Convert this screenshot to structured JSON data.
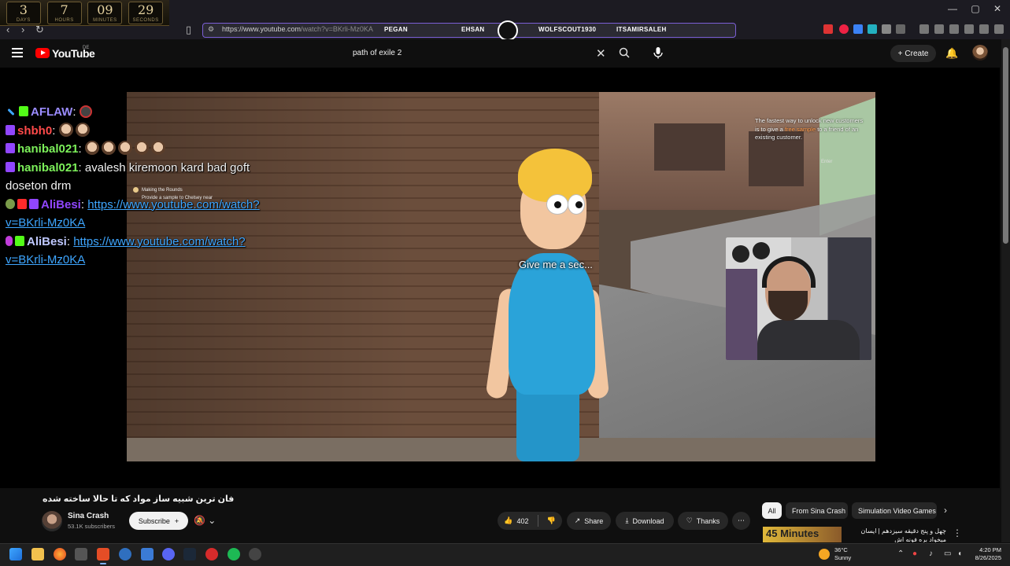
{
  "countdown": {
    "days": "3",
    "days_label": "DAYS",
    "hours": "7",
    "hours_label": "HOURS",
    "minutes": "09",
    "minutes_label": "MINUTES",
    "seconds": "29",
    "seconds_label": "SECONDS"
  },
  "browser": {
    "url_main": "https://www.youtube.com",
    "url_rest": "/watch?v=BKrli-Mz0KA",
    "tags": [
      "PEGAN",
      "EHSAN",
      "WOLFSCOUT1930",
      "ITSAMIRSALEH"
    ]
  },
  "youtube": {
    "wordmark": "YouTube",
    "region": "DE",
    "search_value": "path of exile 2",
    "create_label": "Create"
  },
  "chat": [
    {
      "user": "AFLAW",
      "color": "#9b8cff",
      "text": ""
    },
    {
      "user": "shbh0",
      "color": "#ff4a4a",
      "text": ""
    },
    {
      "user": "hanibal021",
      "color": "#7cf05a",
      "text": ""
    },
    {
      "user": "hanibal021",
      "color": "#7cf05a",
      "text": "avalesh kiremoon kard bad goft"
    },
    {
      "text_cont": "doseton drm"
    },
    {
      "user": "AliBesi",
      "color": "#9146ff",
      "link": "https://www.youtube.com/watch?"
    },
    {
      "link_cont": "v=BKrli-Mz0KA"
    },
    {
      "user": "AliBesi",
      "color": "#bfc8ff",
      "link": "https://www.youtube.com/watch?"
    },
    {
      "link_cont2": "v=BKrli-Mz0KA"
    }
  ],
  "game": {
    "subtitle": "Give me a sec...",
    "quest_title": "Making the Rounds",
    "quest_desc": "Provide a sample to Chelsey near",
    "hint_a": "The fastest way to unlock new customers is to give a ",
    "hint_hl": "free sample",
    "hint_b": " to a friend of an existing customer.",
    "hint_enter": "Enter"
  },
  "video": {
    "title": "فان ترین شبیه ساز مواد که تا حالا ساخته شده",
    "channel": "Sina Crash",
    "subscribers": "53.1K subscribers",
    "subscribe_label": "Subscribe",
    "likes": "402",
    "share_label": "Share",
    "download_label": "Download",
    "thanks_label": "Thanks"
  },
  "chips": [
    "All",
    "From Sina Crash",
    "Simulation Video Games"
  ],
  "recommendation": {
    "thumb_text": "45 Minutes",
    "title": "چهل و پنج دقیقه سیزدهم | ایسان میخواد بره فونه اش"
  },
  "taskbar": {
    "temp": "36°C",
    "condition": "Sunny",
    "time": "4:20 PM",
    "date": "8/26/2025"
  }
}
